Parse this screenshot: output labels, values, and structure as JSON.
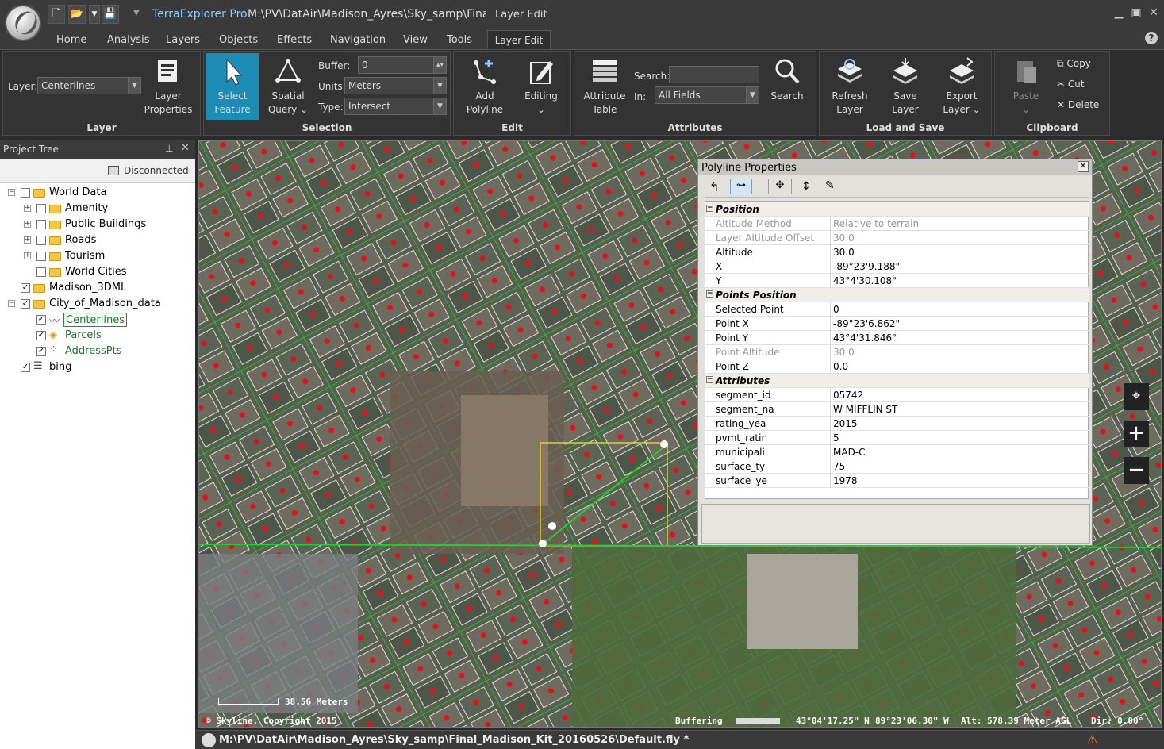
{
  "titlebar": {
    "app_name": "TerraExplorer Pro",
    "path": "M:\\PV\\DatAir\\Madison_Ayres\\Sky_samp\\Final_...",
    "context_tab": "Layer Edit",
    "qat": [
      "new-icon",
      "open-icon",
      "dropdown-icon",
      "save-icon"
    ]
  },
  "tabs": [
    "Home",
    "Analysis",
    "Layers",
    "Objects",
    "Effects",
    "Navigation",
    "View",
    "Tools",
    "Layer Edit"
  ],
  "ribbon": {
    "layer_group": {
      "label": "Layer",
      "layer_label": "Layer:",
      "layer_value": "Centerlines",
      "props_line1": "Layer",
      "props_line2": "Properties"
    },
    "selection_group": {
      "label": "Selection",
      "select_line1": "Select",
      "select_line2": "Feature",
      "spatial_line1": "Spatial",
      "spatial_line2": "Query",
      "buffer_label": "Buffer:",
      "buffer_value": "0",
      "units_label": "Units:",
      "units_value": "Meters",
      "type_label": "Type:",
      "type_value": "Intersect"
    },
    "edit_group": {
      "label": "Edit",
      "add_line1": "Add",
      "add_line2": "Polyline",
      "editing": "Editing"
    },
    "attributes_group": {
      "label": "Attributes",
      "table_line1": "Attribute",
      "table_line2": "Table",
      "search_label": "Search:",
      "in_label": "In:",
      "in_value": "All Fields",
      "search": "Search"
    },
    "load_save_group": {
      "label": "Load and Save",
      "refresh_line1": "Refresh",
      "refresh_line2": "Layer",
      "save_line1": "Save",
      "save_line2": "Layer",
      "export_line1": "Export",
      "export_line2": "Layer"
    },
    "clipboard_group": {
      "label": "Clipboard",
      "paste": "Paste",
      "copy": "Copy",
      "cut": "Cut",
      "delete": "Delete"
    }
  },
  "project_tree": {
    "title": "Project Tree",
    "status": "Disconnected",
    "items": [
      {
        "label": "World Data",
        "checked": false
      },
      {
        "label": "Amenity",
        "checked": false
      },
      {
        "label": "Public Buildings",
        "checked": false
      },
      {
        "label": "Roads",
        "checked": false
      },
      {
        "label": "Tourism",
        "checked": false
      },
      {
        "label": "World Cities",
        "checked": false
      },
      {
        "label": "Madison_3DML",
        "checked": true
      },
      {
        "label": "City_of_Madison_data",
        "checked": true
      },
      {
        "label": "Centerlines",
        "checked": true
      },
      {
        "label": "Parcels",
        "checked": true
      },
      {
        "label": "AddressPts",
        "checked": true
      },
      {
        "label": "bing",
        "checked": true
      }
    ]
  },
  "polyline_properties": {
    "title": "Polyline Properties",
    "position_section": "Position",
    "position": [
      {
        "k": "Altitude Method",
        "v": "Relative to terrain"
      },
      {
        "k": "Layer Altitude Offset",
        "v": "30.0"
      },
      {
        "k": "Altitude",
        "v": "30.0"
      },
      {
        "k": "X",
        "v": "-89°23'9.188\""
      },
      {
        "k": "Y",
        "v": "43°4'30.108\""
      }
    ],
    "points_section": "Points Position",
    "points": [
      {
        "k": "Selected Point",
        "v": "0"
      },
      {
        "k": "Point X",
        "v": "-89°23'6.862\""
      },
      {
        "k": "Point Y",
        "v": "43°4'31.846\""
      },
      {
        "k": "Point Altitude",
        "v": "30.0"
      },
      {
        "k": "Point Z",
        "v": "0.0"
      }
    ],
    "attributes_section": "Attributes",
    "attributes": [
      {
        "k": "segment_id",
        "v": "05742"
      },
      {
        "k": "segment_na",
        "v": "W MIFFLIN ST"
      },
      {
        "k": "rating_yea",
        "v": "2015"
      },
      {
        "k": "pvmt_ratin",
        "v": "5"
      },
      {
        "k": "municipali",
        "v": "MAD-C"
      },
      {
        "k": "surface_ty",
        "v": "75"
      },
      {
        "k": "surface_ye",
        "v": "1978"
      }
    ]
  },
  "map": {
    "scale": "38.56 Meters",
    "copyright": "© Skyline, Copyright 2015",
    "buffering": "Buffering",
    "lat": "43°04'17.25\" N",
    "lon": "89°23'06.30\" W",
    "alt": "Alt: 578.39 Meter AGL",
    "dir": "Dir: 0.00°"
  },
  "bottombar": {
    "path": "M:\\PV\\DatAir\\Madison_Ayres\\Sky_samp\\Final_Madison_Kit_20160526\\Default.fly *"
  }
}
